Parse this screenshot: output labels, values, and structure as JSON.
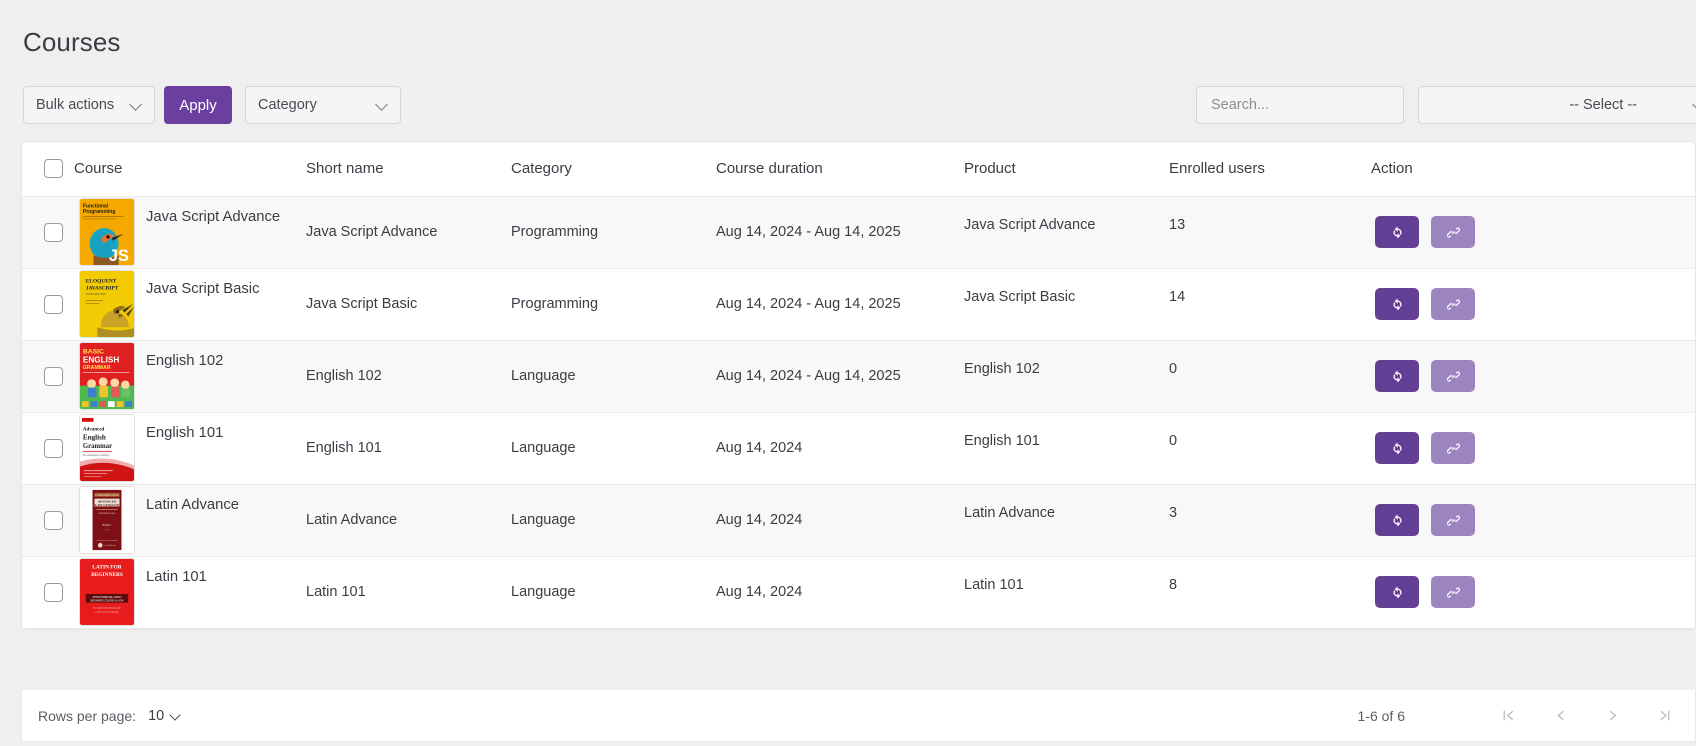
{
  "page": {
    "title": "Courses"
  },
  "toolbar": {
    "bulk_actions_label": "Bulk actions",
    "apply_label": "Apply",
    "category_label": "Category",
    "search_placeholder": "Search...",
    "status_select_label": "-- Select --"
  },
  "table": {
    "columns": [
      "Course",
      "Short name",
      "Category",
      "Course duration",
      "Product",
      "Enrolled users",
      "Action"
    ],
    "rows": [
      {
        "course": "Java Script Advance",
        "short_name": "Java Script Advance",
        "category": "Programming",
        "duration": "Aug 14, 2024 - Aug 14, 2025",
        "product": "Java Script Advance",
        "enrolled_users": "13",
        "cover": "functional-programming-js"
      },
      {
        "course": "Java Script Basic",
        "short_name": "Java Script Basic",
        "category": "Programming",
        "duration": "Aug 14, 2024 - Aug 14, 2025",
        "product": "Java Script Basic",
        "enrolled_users": "14",
        "cover": "eloquent-javascript"
      },
      {
        "course": "English 102",
        "short_name": "English 102",
        "category": "Language",
        "duration": "Aug 14, 2024 - Aug 14, 2025",
        "product": "English 102",
        "enrolled_users": "0",
        "cover": "basic-english-grammar"
      },
      {
        "course": "English 101",
        "short_name": "English 101",
        "category": "Language",
        "duration": "Aug 14, 2024",
        "product": "English 101",
        "enrolled_users": "0",
        "cover": "advanced-english-grammar"
      },
      {
        "course": "Latin Advance",
        "short_name": "Latin Advance",
        "category": "Language",
        "duration": "Aug 14, 2024",
        "product": "Latin Advance",
        "enrolled_users": "3",
        "cover": "advanced-law-lexicon"
      },
      {
        "course": "Latin 101",
        "short_name": "Latin 101",
        "category": "Language",
        "duration": "Aug 14, 2024",
        "product": "Latin 101",
        "enrolled_users": "8",
        "cover": "latin-for-beginners"
      }
    ],
    "row_actions": {
      "sync_icon": "sync-icon",
      "link_icon": "link-icon"
    }
  },
  "footer": {
    "rows_per_page_label": "Rows per page:",
    "rows_per_page_value": "10",
    "range_label": "1-6 of 6",
    "pagination": {
      "first": "first-page-icon",
      "previous": "previous-page-icon",
      "next": "next-page-icon",
      "last": "last-page-icon"
    }
  },
  "colors": {
    "accent": "#6b3fa0",
    "action_sync": "#633f96",
    "action_link": "#9b84c0",
    "page_background": "#efefef"
  }
}
